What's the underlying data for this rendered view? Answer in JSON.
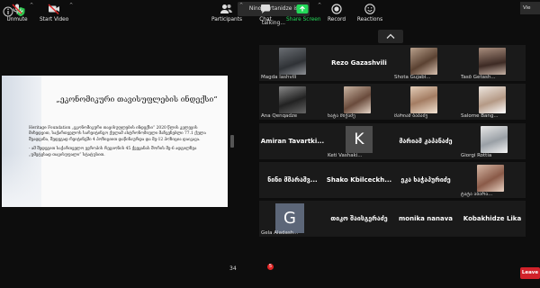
{
  "top_bar": {
    "speaking_indicator": "Nino Kurtanidze is talking...",
    "view_label": "Vie"
  },
  "slide": {
    "title": "„ეკონომიკური თავისუფლების ინდექსი“",
    "paragraph_1": "Heritage Foundation „ეკონომიკური თავისუფლების ინდექსი“ 2020 წლის კვლევის მიხედვით, საქართველოს სარეიტინგო ქულამ ასტრონომიული მაჩვენებლი 77.1 ქულა შეადგინა, შედეგად რეიტინგში 4 პოზიციით დაწინაურდა და მე-12 პოზიცია დაიკავა.",
    "paragraph_2": "- ამ შედეგით საქართველო ევროპის რეგიონის 45 ქვეყანას შორის მე-6 ადგილზეა „უმეტესად თავისუფალი“ სტატუსით."
  },
  "participants": [
    {
      "name": "Magda lashvili",
      "display": "label"
    },
    {
      "name": "Rezo Gazashvili",
      "display": "center"
    },
    {
      "name": "Shota Gujabi...",
      "display": "label"
    },
    {
      "name": "Tasō Getash...",
      "display": "label"
    },
    {
      "name": "Ana Qenqadze",
      "display": "label"
    },
    {
      "name": "ნატა მიქაძე",
      "display": "label"
    },
    {
      "name": "მარიამ ბაბაძე",
      "display": "label"
    },
    {
      "name": "Salome Bang...",
      "display": "label"
    },
    {
      "name": "Amiran Tavartki...",
      "display": "center"
    },
    {
      "name": "Keti Vashaki...",
      "display": "label",
      "initial": "K"
    },
    {
      "name": "მარიამ კაპანაძე",
      "display": "center"
    },
    {
      "name": "Giorgi Rottia",
      "display": "label"
    },
    {
      "name": "ნინი მშარაშვ...",
      "display": "center"
    },
    {
      "name": "Shako Kbilceckh...",
      "display": "center"
    },
    {
      "name": "ეკა ხაჭაპურიძე",
      "display": "center"
    },
    {
      "name": "ტატა აბარა...",
      "display": "label"
    },
    {
      "name": "Gela Aladash...",
      "display": "label",
      "initial": "G"
    },
    {
      "name": "თიკო შაისგერაძე",
      "display": "center"
    },
    {
      "name": "monika nanava",
      "display": "center"
    },
    {
      "name": "Kobakhidze Lika",
      "display": "center"
    }
  ],
  "toolbar": {
    "unmute": "Unmute",
    "start_video": "Start Video",
    "participants": "Participants",
    "participants_count": "34",
    "chat": "Chat",
    "chat_badge": "5",
    "share_screen": "Share Screen",
    "record": "Record",
    "reactions": "Reactions",
    "leave": "Leave"
  },
  "colors": {
    "meeting_bg": "#0d0d0d",
    "tile_bg": "#1a1a1a",
    "share_green": "#23d959",
    "leave_red": "#d1222a",
    "badge_red": "#e02424"
  }
}
